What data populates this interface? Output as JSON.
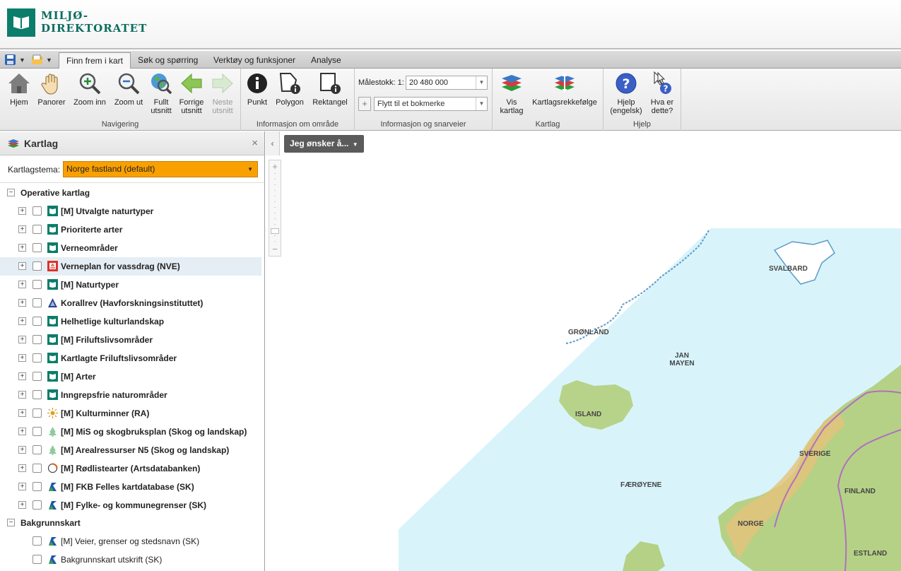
{
  "header": {
    "logo_line1": "MILJØ-",
    "logo_line2": "DIREKTORATET"
  },
  "tabs": [
    {
      "label": "Finn frem i kart",
      "active": true
    },
    {
      "label": "Søk og spørring"
    },
    {
      "label": "Verktøy og funksjoner"
    },
    {
      "label": "Analyse"
    }
  ],
  "ribbon": {
    "navigation": {
      "label": "Navigering",
      "buttons": [
        {
          "label": "Hjem",
          "icon": "home-icon"
        },
        {
          "label": "Panorer",
          "icon": "hand-icon"
        },
        {
          "label": "Zoom inn",
          "icon": "zoom-in-icon"
        },
        {
          "label": "Zoom ut",
          "icon": "zoom-out-icon"
        },
        {
          "label1": "Fullt",
          "label2": "utsnitt",
          "icon": "globe-icon"
        },
        {
          "label1": "Forrige",
          "label2": "utsnitt",
          "icon": "arrow-left-icon"
        },
        {
          "label1": "Neste",
          "label2": "utsnitt",
          "icon": "arrow-right-icon",
          "disabled": true
        }
      ]
    },
    "info_area": {
      "label": "Informasjon om område",
      "buttons": [
        {
          "label": "Punkt",
          "icon": "info-point-icon"
        },
        {
          "label": "Polygon",
          "icon": "info-polygon-icon"
        },
        {
          "label": "Rektangel",
          "icon": "info-rectangle-icon"
        }
      ]
    },
    "info_shortcuts": {
      "label": "Informasjon og snarveier",
      "scale_label": "Målestokk: 1:",
      "scale_value": "20 480 000",
      "bookmark_placeholder": "Flytt til et bokmerke",
      "add_symbol": "+"
    },
    "map_layers": {
      "label": "Kartlag",
      "buttons": [
        {
          "label1": "Vis",
          "label2": "kartlag",
          "icon": "layers-icon"
        },
        {
          "label": "Kartlagsrekkefølge",
          "icon": "layer-order-icon"
        }
      ]
    },
    "help": {
      "label": "Hjelp",
      "buttons": [
        {
          "label1": "Hjelp",
          "label2": "(engelsk)",
          "icon": "help-icon"
        },
        {
          "label1": "Hva er",
          "label2": "dette?",
          "icon": "whats-this-icon"
        }
      ]
    }
  },
  "panel": {
    "title": "Kartlag",
    "close": "×",
    "theme_label": "Kartlagstema:",
    "theme_value": "Norge fastland (default)",
    "operative": {
      "title": "Operative kartlag",
      "layers": [
        {
          "label": "[M] Utvalgte naturtyper",
          "icon": "miljodir"
        },
        {
          "label": "Prioriterte arter",
          "icon": "miljodir"
        },
        {
          "label": "Verneområder",
          "icon": "miljodir"
        },
        {
          "label": "Verneplan for vassdrag (NVE)",
          "icon": "nve",
          "highlight": true
        },
        {
          "label": "[M] Naturtyper",
          "icon": "miljodir"
        },
        {
          "label": "Korallrev (Havforskningsinstituttet)",
          "icon": "havforskning"
        },
        {
          "label": "Helhetlige kulturlandskap",
          "icon": "miljodir"
        },
        {
          "label": "[M] Friluftslivsområder",
          "icon": "miljodir"
        },
        {
          "label": "Kartlagte Friluftslivsområder",
          "icon": "miljodir"
        },
        {
          "label": "[M] Arter",
          "icon": "miljodir"
        },
        {
          "label": "Inngrepsfrie naturområder",
          "icon": "miljodir"
        },
        {
          "label": "[M] Kulturminner (RA)",
          "icon": "riksantikvaren"
        },
        {
          "label": "[M] MiS og skogbruksplan (Skog og landskap)",
          "icon": "tree"
        },
        {
          "label": "[M] Arealressurser N5 (Skog og landskap)",
          "icon": "tree"
        },
        {
          "label": "[M] Rødlistearter (Artsdatabanken)",
          "icon": "artsdatabanken"
        },
        {
          "label": "[M] FKB Felles kartdatabase (SK)",
          "icon": "kartverket"
        },
        {
          "label": "[M] Fylke- og kommunegrenser (SK)",
          "icon": "kartverket"
        }
      ]
    },
    "background": {
      "title": "Bakgrunnskart",
      "layers": [
        {
          "label": "[M] Veier, grenser og stedsnavn (SK)",
          "icon": "kartverket"
        },
        {
          "label": "Bakgrunnskart utskrift (SK)",
          "icon": "kartverket"
        }
      ]
    }
  },
  "map": {
    "want_button": "Jeg ønsker å...",
    "labels": [
      "SVALBARD",
      "GRØNLAND",
      "JAN MAYEN",
      "ISLAND",
      "SVERIGE",
      "FÆRØYENE",
      "FINLAND",
      "NORGE",
      "ESTLAND"
    ],
    "colors": {
      "sea": "#d8f4fa",
      "land": "#b5d186",
      "border": "#b070c0"
    }
  }
}
